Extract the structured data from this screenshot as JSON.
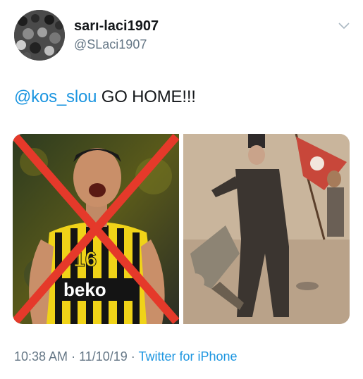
{
  "user": {
    "display_name": "sarı-laci1907",
    "handle": "@SLaci1907"
  },
  "tweet": {
    "mention": "@kos_slou",
    "text": " GO HOME!!!"
  },
  "media": {
    "left_jersey_number": "16",
    "left_sponsor_text": "beko",
    "left_overlay": "red X"
  },
  "footer": {
    "time": "10:38 AM",
    "separator": " · ",
    "date": "11/10/19",
    "separator2": " · ",
    "source": "Twitter for iPhone"
  },
  "colors": {
    "link": "#1b95e0",
    "text": "#14171a",
    "secondary": "#657786",
    "overlay_red": "#e5392a"
  },
  "icons": {
    "chevron": "chevron-down-icon"
  }
}
